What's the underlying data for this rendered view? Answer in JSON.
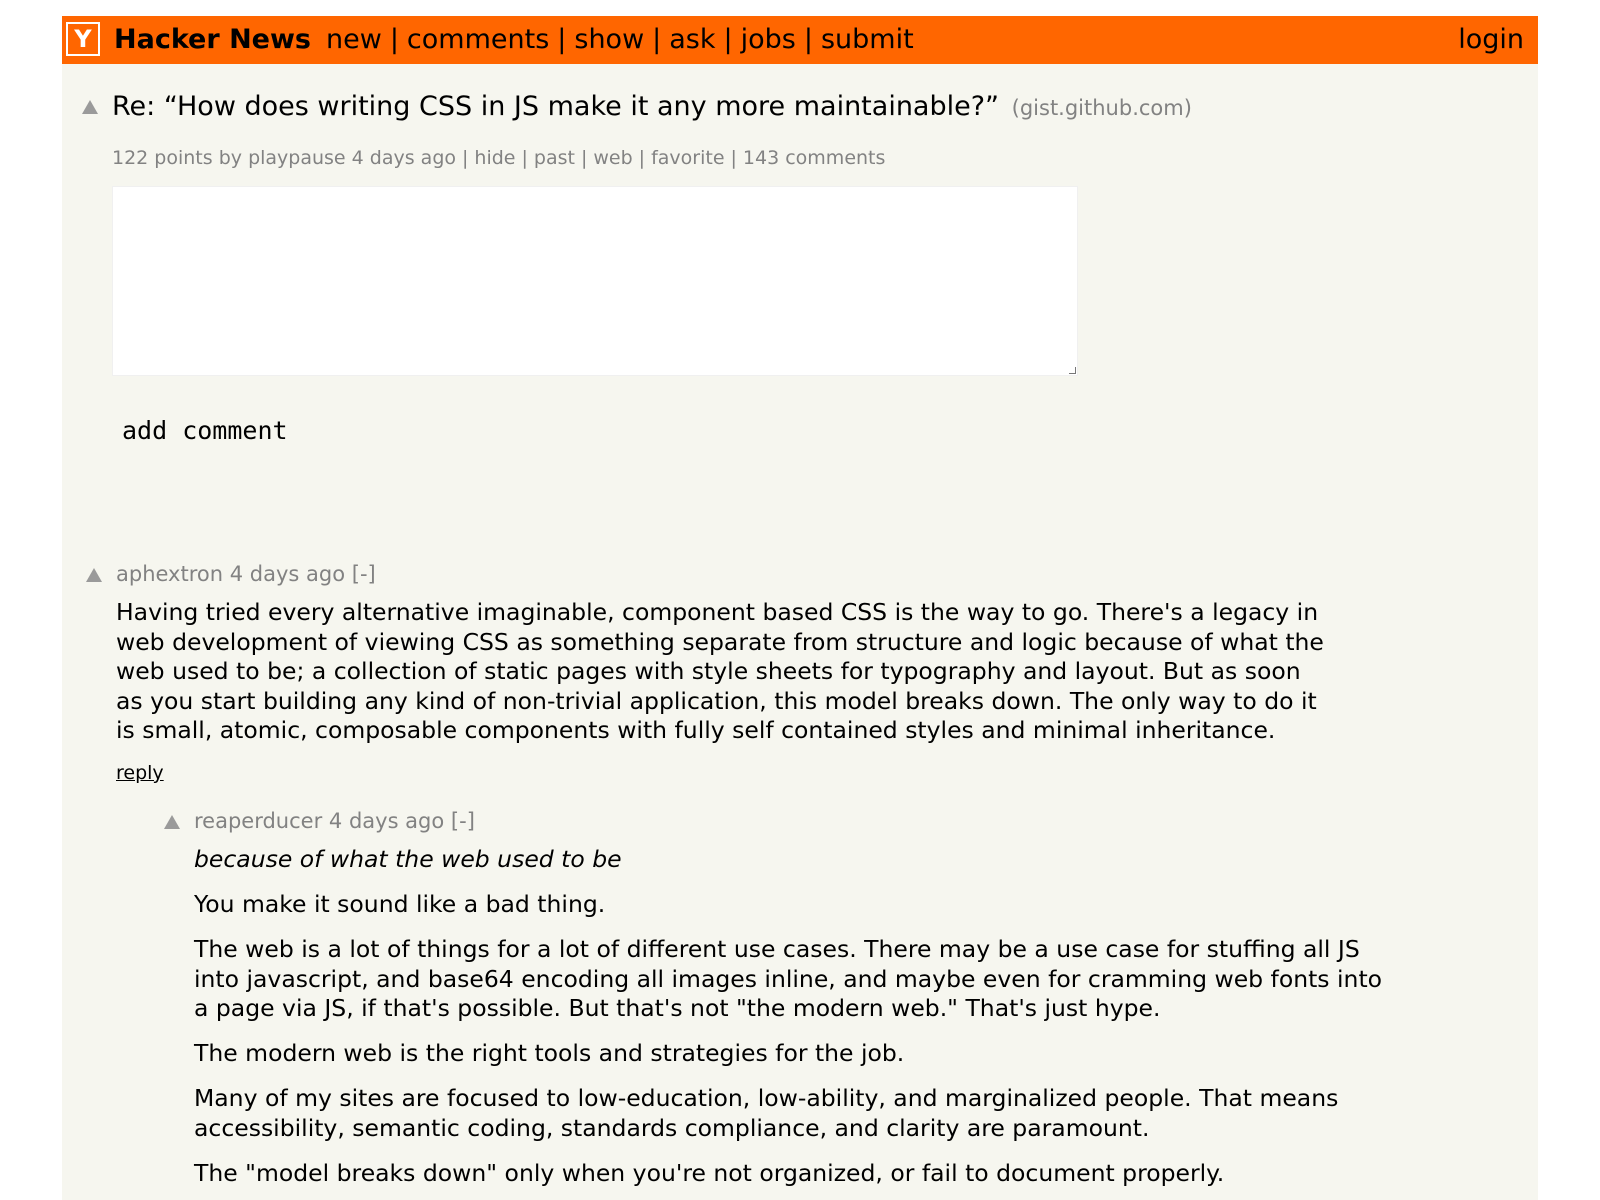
{
  "header": {
    "logo": "Y",
    "brand": "Hacker News",
    "nav": [
      "new",
      "comments",
      "show",
      "ask",
      "jobs",
      "submit"
    ],
    "login": "login",
    "colors": {
      "header_bg": "#ff6600",
      "page_bg": "#f6f6ef",
      "muted_text": "#828282"
    }
  },
  "story": {
    "title": "Re: “How does writing CSS in JS make it any more maintainable?”",
    "site": "(gist.github.com)",
    "subtext": {
      "points_by": "122 points by",
      "user": "playpause",
      "age": "4 days ago",
      "links": [
        "hide",
        "past",
        "web",
        "favorite",
        "143 comments"
      ]
    }
  },
  "comment_form": {
    "textarea_value": "",
    "submit_label": "add comment"
  },
  "comments": [
    {
      "user": "aphextron",
      "age": "4 days ago",
      "toggle": "[-]",
      "lines": [
        "Having tried every alternative imaginable, component based CSS is the way to go. There's a legacy in",
        "web development of viewing CSS as something separate from structure and logic because of what the",
        "web used to be; a collection of static pages with style sheets for typography and layout. But as soon",
        "as you start building any kind of non-trivial application, this model breaks down. The only way to do it",
        "is small, atomic, composable components with fully self contained styles and minimal inheritance."
      ],
      "reply": "reply"
    },
    {
      "user": "reaperducer",
      "age": "4 days ago",
      "toggle": "[-]",
      "quote": "because of what the web used to be",
      "p1": "You make it sound like a bad thing.",
      "p2": [
        "The web is a lot of things for a lot of different use cases. There may be a use case for stuffing all JS",
        "into javascript, and base64 encoding all images inline, and maybe even for cramming web fonts into",
        "a page via JS, if that's possible. But that's not \"the modern web.\" That's just hype."
      ],
      "p3": "The modern web is the right tools and strategies for the job.",
      "p4": [
        "Many of my sites are focused to low-education, low-ability, and marginalized people. That means",
        "accessibility, semantic coding, standards compliance, and clarity are paramount."
      ],
      "p5": "The \"model breaks down\" only when you're not organized, or fail to document properly."
    }
  ]
}
